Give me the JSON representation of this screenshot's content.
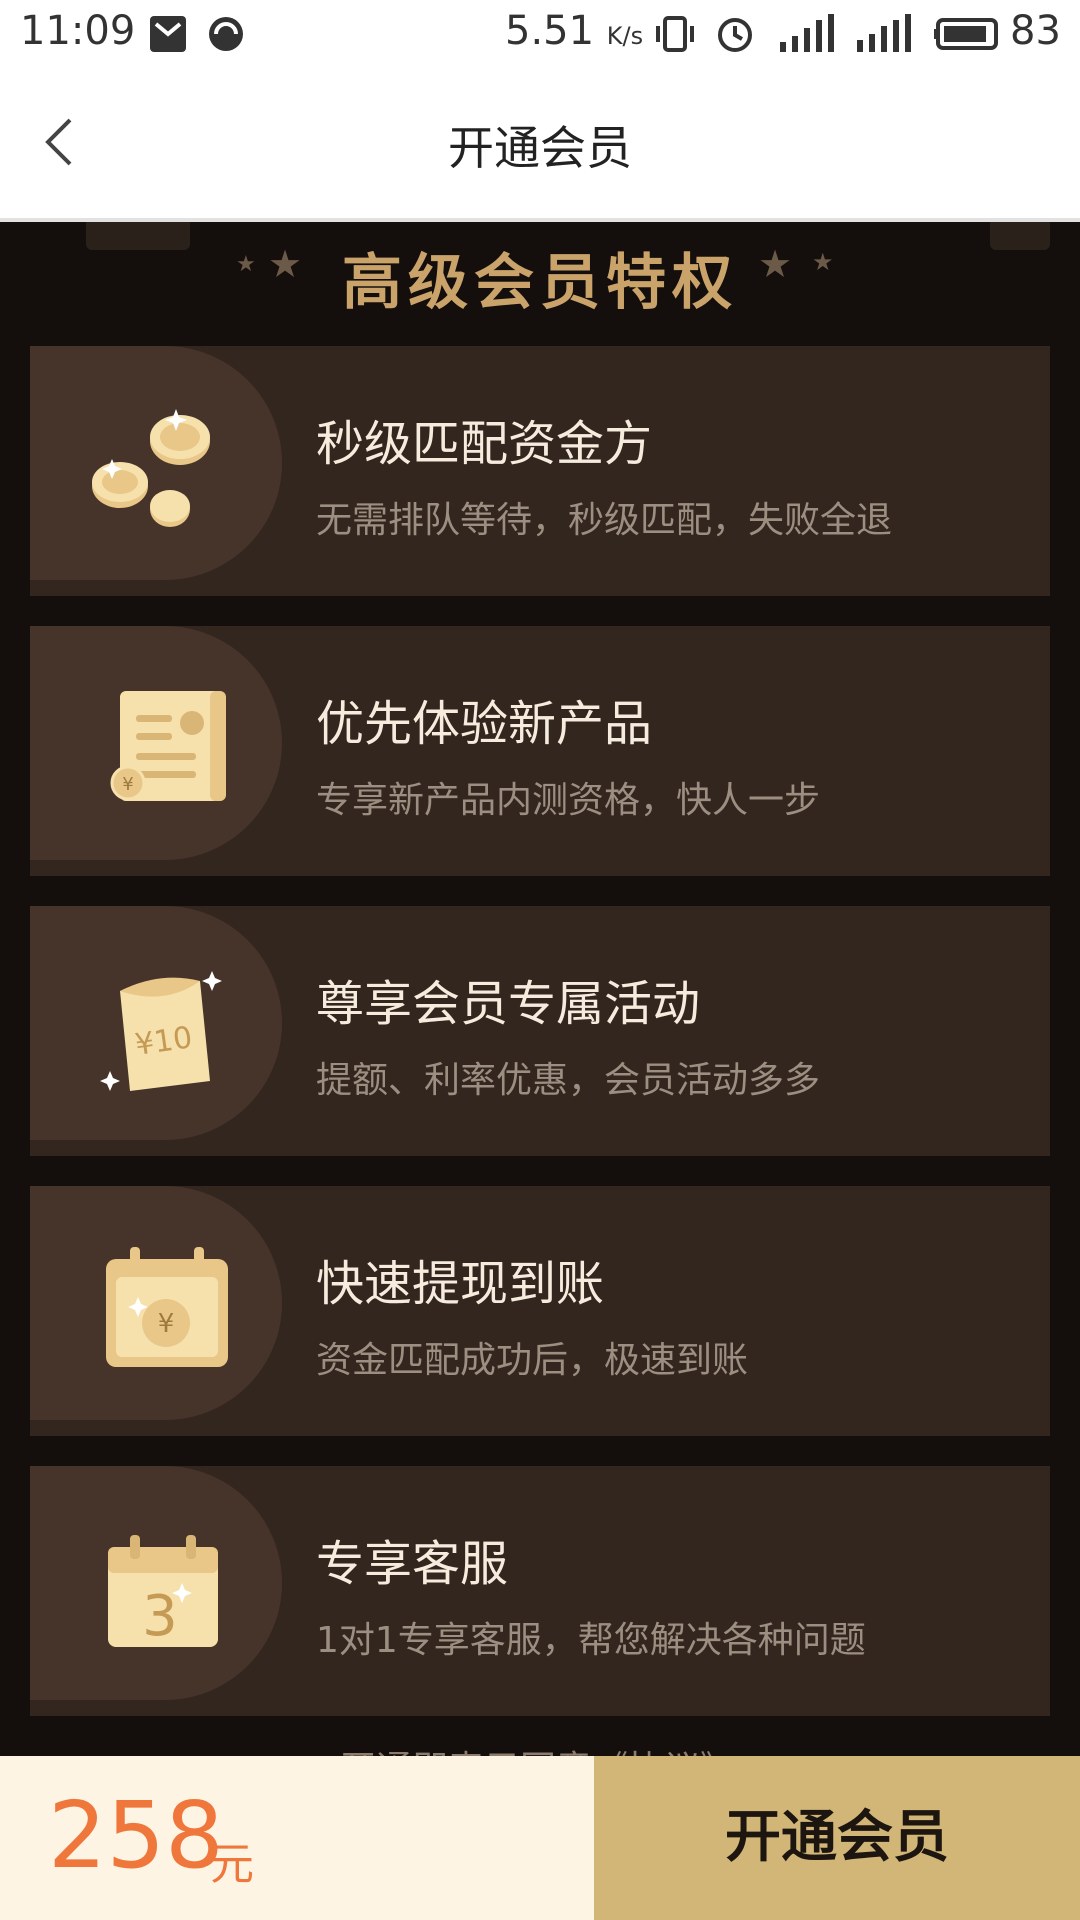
{
  "status_bar": {
    "time": "11:09",
    "speed_value": "5.51",
    "speed_unit": "K/s",
    "battery": "83"
  },
  "header": {
    "title": "开通会员"
  },
  "section": {
    "title": "高级会员特权"
  },
  "benefits": [
    {
      "title": "秒级匹配资金方",
      "desc": "无需排队等待，秒级匹配，失败全退",
      "icon": "coins-icon"
    },
    {
      "title": "优先体验新产品",
      "desc": "专享新产品内测资格，快人一步",
      "icon": "scroll-icon"
    },
    {
      "title": "尊享会员专属活动",
      "desc": "提额、利率优惠，会员活动多多",
      "icon": "coupon-bag-icon",
      "icon_text": "¥10"
    },
    {
      "title": "快速提现到账",
      "desc": "资金匹配成功后，极速到账",
      "icon": "calendar-coin-icon",
      "icon_text": "¥"
    },
    {
      "title": "专享客服",
      "desc": "1对1专享客服，帮您解决各种问题",
      "icon": "calendar-3-icon",
      "icon_text": "3"
    }
  ],
  "agreement": "开通即表示同意《协议》",
  "bottom": {
    "price": "258",
    "unit": "元",
    "button": "开通会员"
  },
  "colors": {
    "accent": "#d2b678",
    "price": "#f0773c",
    "card": "#33261e",
    "bg": "#140e0c"
  }
}
